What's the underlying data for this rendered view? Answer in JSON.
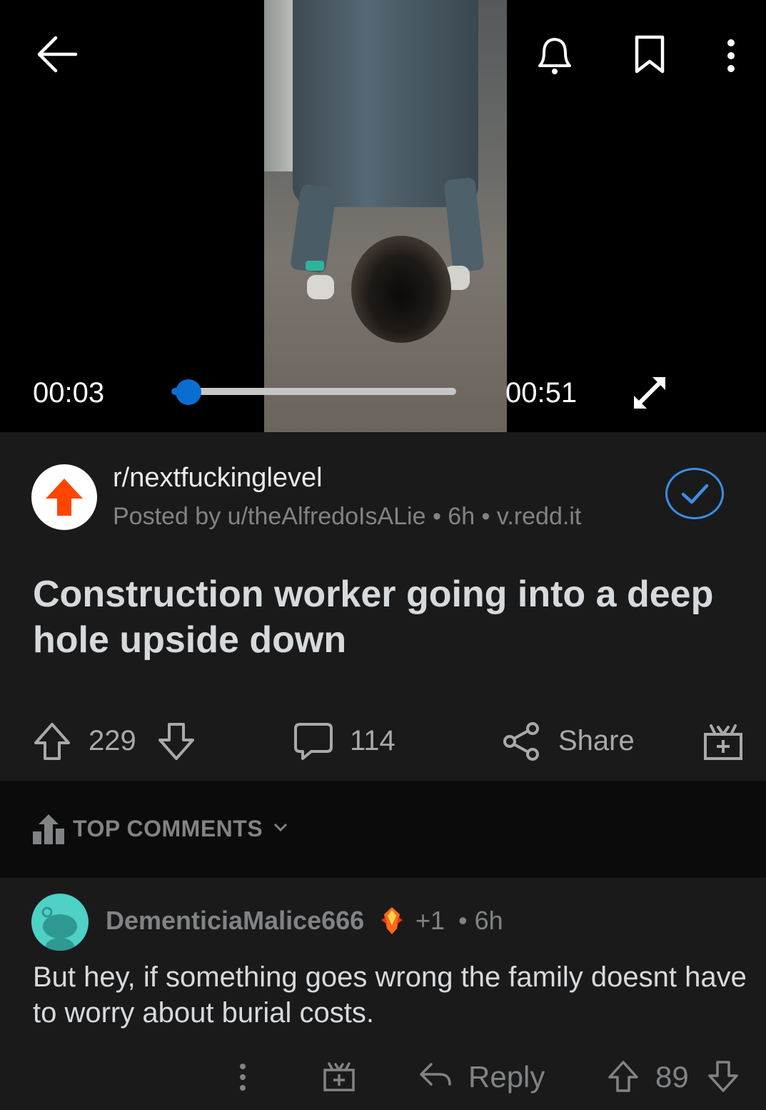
{
  "player": {
    "current_time": "00:03",
    "duration": "00:51",
    "progress": 0.06
  },
  "post": {
    "subreddit": "r/nextfuckinglevel",
    "meta": "Posted by u/theAlfredoIsALie • 6h • v.redd.it",
    "title": "Construction worker going into a deep hole upside down",
    "score": "229",
    "comments": "114",
    "share_label": "Share"
  },
  "comments_section": {
    "sort_label": "TOP COMMENTS"
  },
  "comment": {
    "username": "DementiciaMalice666",
    "award_count": "+1",
    "age": "• 6h",
    "body": "But hey, if something goes wrong the family doesnt have to worry about burial costs.",
    "reply_label": "Reply",
    "score": "89"
  },
  "colors": {
    "accent_blue": "#0a6ed1",
    "reddit_orange": "#ff4500",
    "check_blue": "#3a8fe8"
  }
}
